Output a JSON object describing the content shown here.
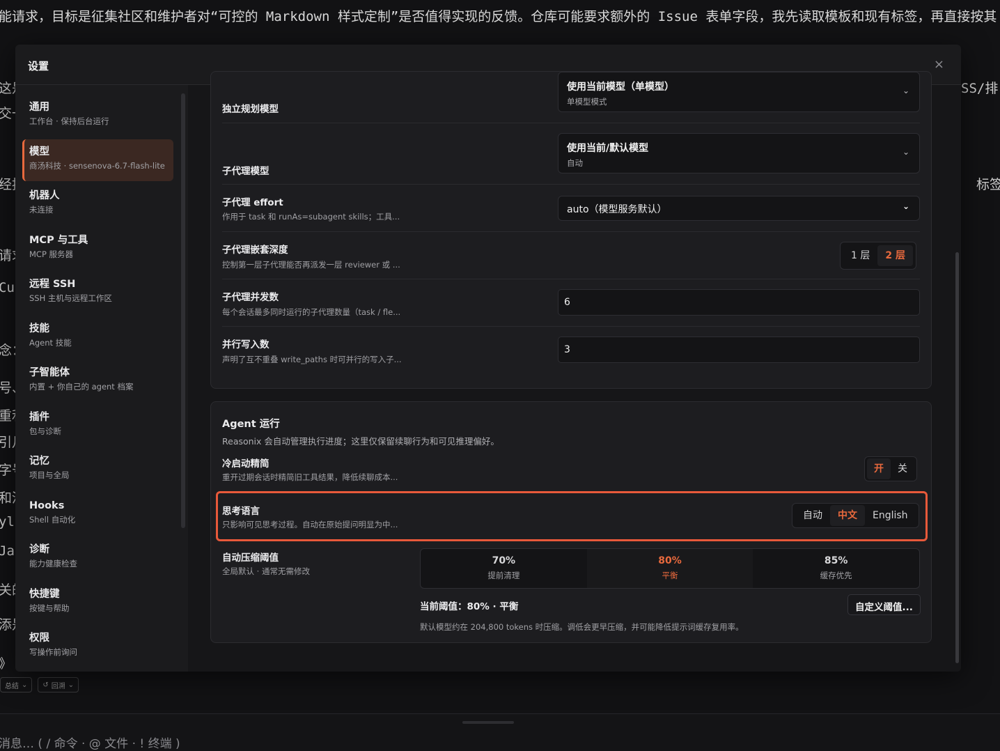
{
  "background": {
    "top_text": "能请求，目标是征集社区和维护者对“可控的 Markdown 样式定制”是否值得实现的反馈。仓库可能要求额外的 Issue 表单字段，我先读取模板和现有标签，再直接按其",
    "left_fragments": [
      "这是",
      "交一",
      "经按",
      "请求",
      "Cus",
      "念：",
      "号、",
      "重利",
      "引月",
      "字号",
      "和河",
      "yle",
      "Ja",
      "关的",
      "添是",
      "》 利"
    ],
    "right_fragments": [
      "SS/排",
      "标签"
    ],
    "chips": [
      "总结",
      "回溯"
    ],
    "composer_placeholder": "消息…  ( / 命令 · @ 文件 · ! 终端 )"
  },
  "modal": {
    "title": "设置",
    "close_icon": "×"
  },
  "sidebar": {
    "items": [
      {
        "title": "通用",
        "sub": "工作台 · 保持后台运行"
      },
      {
        "title": "模型",
        "sub": "商汤科技 · sensenova-6.7-flash-lite"
      },
      {
        "title": "机器人",
        "sub": "未连接"
      },
      {
        "title": "MCP 与工具",
        "sub": "MCP 服务器"
      },
      {
        "title": "远程 SSH",
        "sub": "SSH 主机与远程工作区"
      },
      {
        "title": "技能",
        "sub": "Agent 技能"
      },
      {
        "title": "子智能体",
        "sub": "内置 + 你自己的 agent 档案"
      },
      {
        "title": "插件",
        "sub": "包与诊断"
      },
      {
        "title": "记忆",
        "sub": "项目与全局"
      },
      {
        "title": "Hooks",
        "sub": "Shell 自动化"
      },
      {
        "title": "诊断",
        "sub": "能力健康检查"
      },
      {
        "title": "快捷键",
        "sub": "按键与帮助"
      },
      {
        "title": "权限",
        "sub": "写操作前询问"
      }
    ],
    "active_index": 1
  },
  "models_card": {
    "planner": {
      "label": "独立规划模型",
      "value": "使用当前模型（单模型）",
      "sub": "单模型模式"
    },
    "subagent": {
      "label": "子代理模型",
      "value": "使用当前/默认模型",
      "sub": "自动"
    },
    "effort": {
      "label": "子代理 effort",
      "desc": "作用于 task 和 runAs=subagent skills；工具...",
      "value": "auto（模型服务默认）"
    },
    "depth": {
      "label": "子代理嵌套深度",
      "desc": "控制第一层子代理能否再派发一层 reviewer 或 ...",
      "options": [
        "1 层",
        "2 层"
      ],
      "selected": "2 层"
    },
    "concurrency": {
      "label": "子代理并发数",
      "desc": "每个会话最多同时运行的子代理数量（task / fle...",
      "value": "6"
    },
    "parallel_writes": {
      "label": "并行写入数",
      "desc": "声明了互不重叠 write_paths 时可并行的写入子...",
      "value": "3"
    }
  },
  "agent_card": {
    "title": "Agent 运行",
    "desc": "Reasonix 会自动管理执行进度；这里仅保留续聊行为和可见推理偏好。",
    "cold_start": {
      "label": "冷启动精简",
      "desc": "重开过期会话时精简旧工具结果，降低续聊成本...",
      "options": [
        "开",
        "关"
      ],
      "selected": "开"
    },
    "thinking_lang": {
      "label": "思考语言",
      "desc": "只影响可见思考过程。自动在原始提问明显为中...",
      "options": [
        "自动",
        "中文",
        "English"
      ],
      "selected": "中文"
    },
    "compress": {
      "label": "自动压缩阈值",
      "desc": "全局默认 · 通常无需修改",
      "options": [
        {
          "value": "70%",
          "label": "提前清理"
        },
        {
          "value": "80%",
          "label": "平衡"
        },
        {
          "value": "85%",
          "label": "缓存优先"
        }
      ],
      "selected": "80%",
      "current": "当前阈值：80% · 平衡",
      "custom_button": "自定义阈值...",
      "note": "默认模型约在 204,800 tokens 时压缩。调低会更早压缩，并可能降低提示词缓存复用率。"
    }
  },
  "colors": {
    "accent": "#e8693d",
    "highlight": "#e8593a"
  }
}
